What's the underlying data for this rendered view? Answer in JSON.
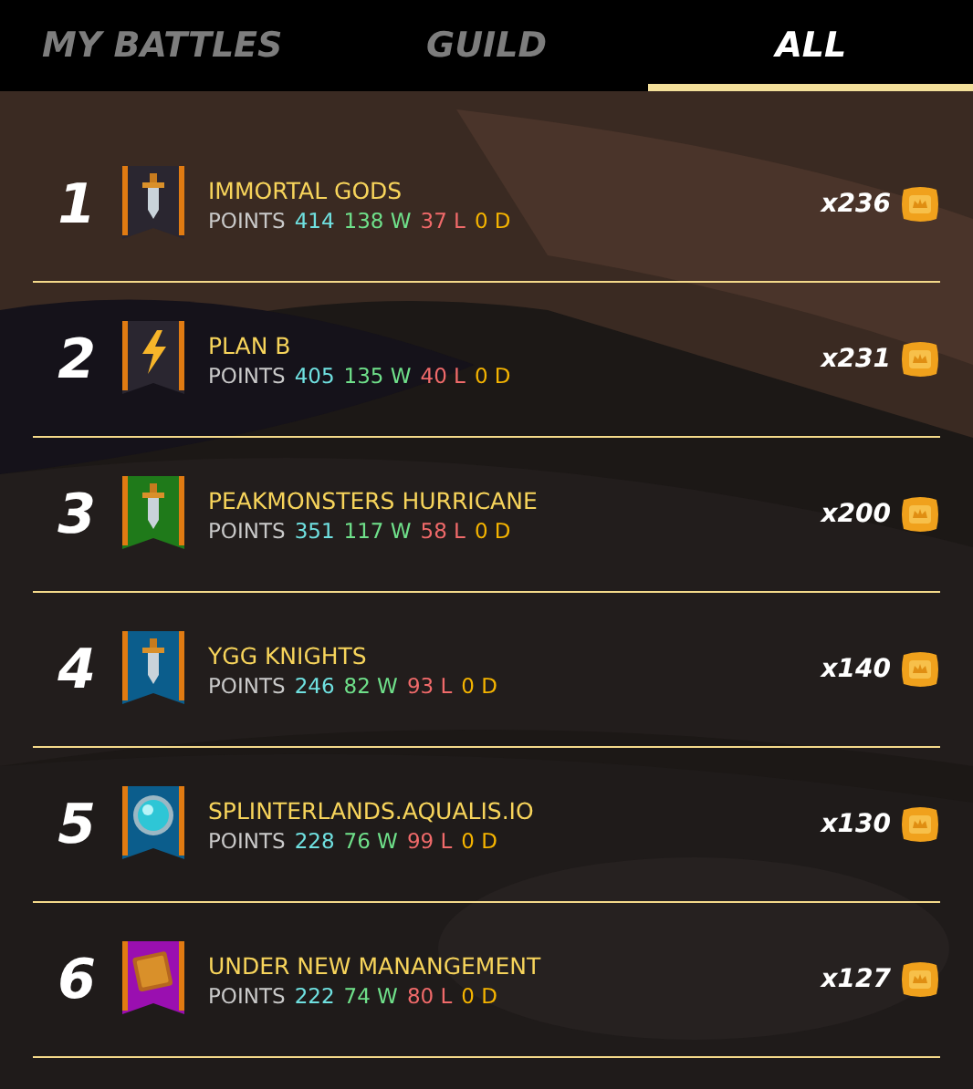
{
  "tabs": [
    {
      "label": "MY BATTLES",
      "selected": false
    },
    {
      "label": "GUILD",
      "selected": false
    },
    {
      "label": "ALL",
      "selected": true
    }
  ],
  "guilds": [
    {
      "rank": "1",
      "name": "IMMORTAL GODS",
      "points_label": "POINTS",
      "points": "414",
      "wins": "138 W",
      "losses": "37 L",
      "draws": "0 D",
      "reward": "x236",
      "color": "#2a2630",
      "kind": "sword"
    },
    {
      "rank": "2",
      "name": "PLAN B",
      "points_label": "POINTS",
      "points": "405",
      "wins": "135 W",
      "losses": "40 L",
      "draws": "0 D",
      "reward": "x231",
      "color": "#2a2630",
      "kind": "bolt"
    },
    {
      "rank": "3",
      "name": "PEAKMONSTERS HURRICANE",
      "points_label": "POINTS",
      "points": "351",
      "wins": "117 W",
      "losses": "58 L",
      "draws": "0 D",
      "reward": "x200",
      "color": "#1f7a1a",
      "kind": "sword"
    },
    {
      "rank": "4",
      "name": "YGG KNIGHTS",
      "points_label": "POINTS",
      "points": "246",
      "wins": "82 W",
      "losses": "93 L",
      "draws": "0 D",
      "reward": "x140",
      "color": "#0b5d8c",
      "kind": "sword"
    },
    {
      "rank": "5",
      "name": "SPLINTERLANDS.AQUALIS.IO",
      "points_label": "POINTS",
      "points": "228",
      "wins": "76 W",
      "losses": "99 L",
      "draws": "0 D",
      "reward": "x130",
      "color": "#0b5d8c",
      "kind": "orb"
    },
    {
      "rank": "6",
      "name": "UNDER NEW MANANGEMENT",
      "points_label": "POINTS",
      "points": "222",
      "wins": "74 W",
      "losses": "80 L",
      "draws": "0 D",
      "reward": "x127",
      "color": "#9a0fb0",
      "kind": "book"
    }
  ]
}
